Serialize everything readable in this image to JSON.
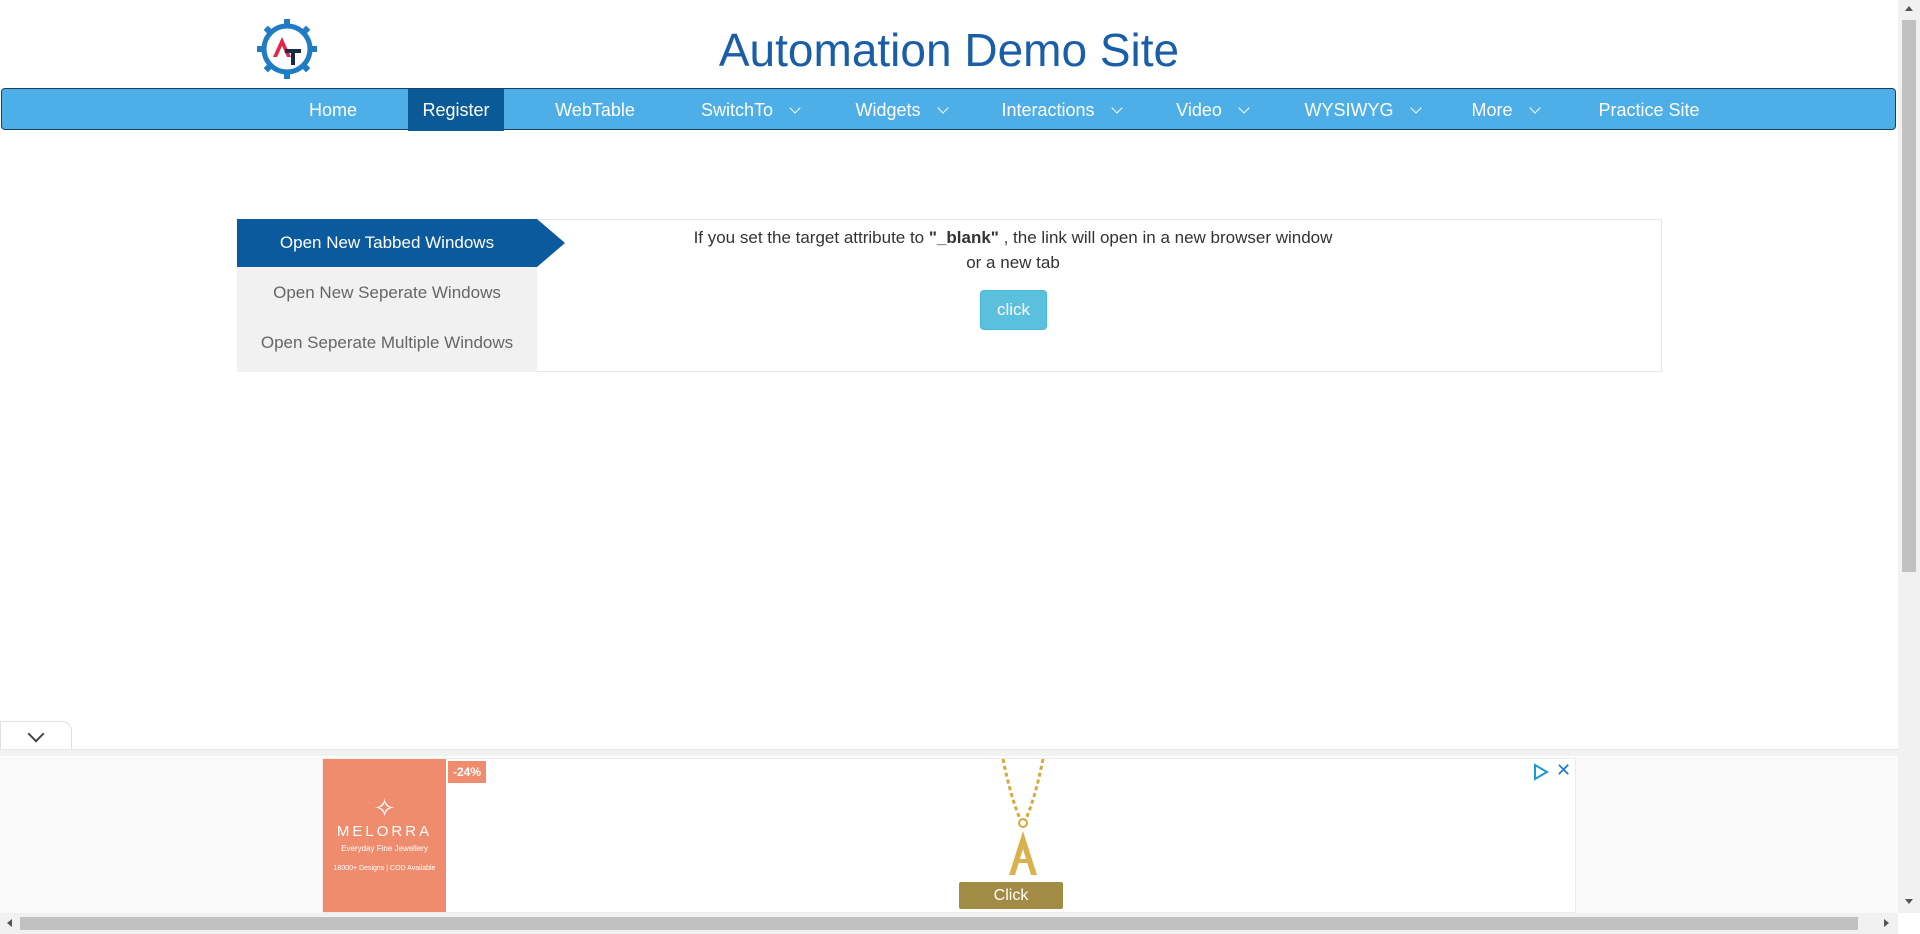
{
  "header": {
    "logo_text": "AT",
    "title": "Automation Demo Site"
  },
  "nav": {
    "items": [
      {
        "label": "Home",
        "dropdown": false
      },
      {
        "label": "Register",
        "dropdown": false,
        "active": true
      },
      {
        "label": "WebTable",
        "dropdown": false
      },
      {
        "label": "SwitchTo",
        "dropdown": true
      },
      {
        "label": "Widgets",
        "dropdown": true
      },
      {
        "label": "Interactions",
        "dropdown": true
      },
      {
        "label": "Video",
        "dropdown": true
      },
      {
        "label": "WYSIWYG",
        "dropdown": true
      },
      {
        "label": "More",
        "dropdown": true
      },
      {
        "label": "Practice Site",
        "dropdown": false
      }
    ]
  },
  "windows": {
    "tabs": [
      {
        "label": "Open New Tabbed Windows",
        "active": true
      },
      {
        "label": "Open New Seperate Windows",
        "active": false
      },
      {
        "label": "Open Seperate Multiple Windows",
        "active": false
      }
    ],
    "description_prefix": "If you set the target attribute to ",
    "description_bold": "\"_blank\"",
    "description_suffix": " , the link will open in a new browser window",
    "description_line2": "or a new tab",
    "button_label": "click"
  },
  "ad": {
    "brand_name": "MELORRA",
    "brand_tagline": "Everyday Fine Jewellery",
    "brand_meta_1": "18000+ Designs",
    "brand_meta_2": "COD Available",
    "discount": "-24%",
    "click_label": "Click",
    "close_glyph": "✕",
    "colors": {
      "brand_bg": "#f08c6e",
      "click_bg": "#a28b45"
    }
  },
  "colors": {
    "title": "#1a5ea8",
    "navbar": "#4eaee8",
    "nav_active": "#0a5a98",
    "tab_active": "#0b5a9d",
    "button": "#5bc0de"
  }
}
